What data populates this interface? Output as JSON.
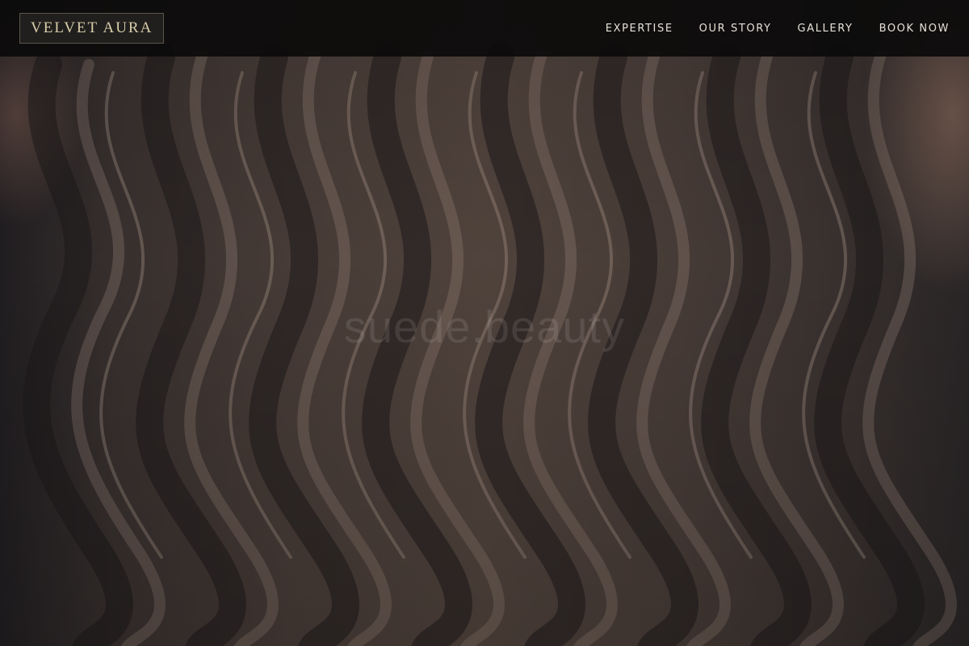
{
  "brand": {
    "name": "VELVET AURA"
  },
  "nav": {
    "items": [
      {
        "label": "EXPERTISE"
      },
      {
        "label": "OUR STORY"
      },
      {
        "label": "GALLERY"
      },
      {
        "label": "BOOK NOW"
      }
    ]
  },
  "hero": {
    "watermark": "suede.beauty"
  },
  "colors": {
    "header_bg": "#0c0b0b",
    "logo_text": "#d8cdaa",
    "nav_text": "#e6e1d8",
    "hair_tone": "#54463f"
  }
}
